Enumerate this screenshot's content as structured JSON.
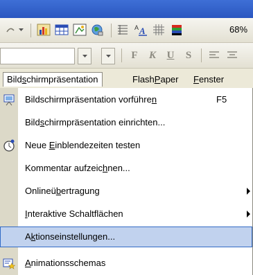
{
  "toolbar": {
    "zoom": "68%",
    "format_buttons": [
      "F",
      "K",
      "U",
      "S"
    ]
  },
  "menubar": {
    "items": [
      {
        "pre": "Bild",
        "acc": "s",
        "post": "chirmpräsentation"
      },
      {
        "pre": "Flash",
        "acc": "P",
        "post": "aper"
      },
      {
        "pre": "",
        "acc": "F",
        "post": "enster"
      }
    ]
  },
  "menu": {
    "items": [
      {
        "pre": "Bildschirmpräsentation vorführe",
        "acc": "n",
        "post": "",
        "shortcut": "F5",
        "icon": "slideshow-icon",
        "submenu": false
      },
      {
        "pre": "Bild",
        "acc": "s",
        "post": "chirmpräsentation einrichten...",
        "shortcut": "",
        "icon": "",
        "submenu": false
      },
      {
        "pre": "Neue ",
        "acc": "E",
        "post": "inblendezeiten testen",
        "shortcut": "",
        "icon": "rehearse-timings-icon",
        "submenu": false
      },
      {
        "pre": "Kommentar aufzeic",
        "acc": "h",
        "post": "nen...",
        "shortcut": "",
        "icon": "",
        "submenu": false
      },
      {
        "pre": "Onlineü",
        "acc": "b",
        "post": "ertragung",
        "shortcut": "",
        "icon": "",
        "submenu": true
      },
      {
        "pre": "",
        "acc": "I",
        "post": "nteraktive Schaltflächen",
        "shortcut": "",
        "icon": "",
        "submenu": true
      },
      {
        "pre": "A",
        "acc": "k",
        "post": "tionseinstellungen...",
        "shortcut": "",
        "icon": "",
        "submenu": false
      },
      {
        "pre": "",
        "acc": "A",
        "post": "nimationsschemas",
        "shortcut": "",
        "icon": "animation-schemes-icon",
        "submenu": false
      }
    ],
    "selected_index": 6
  }
}
